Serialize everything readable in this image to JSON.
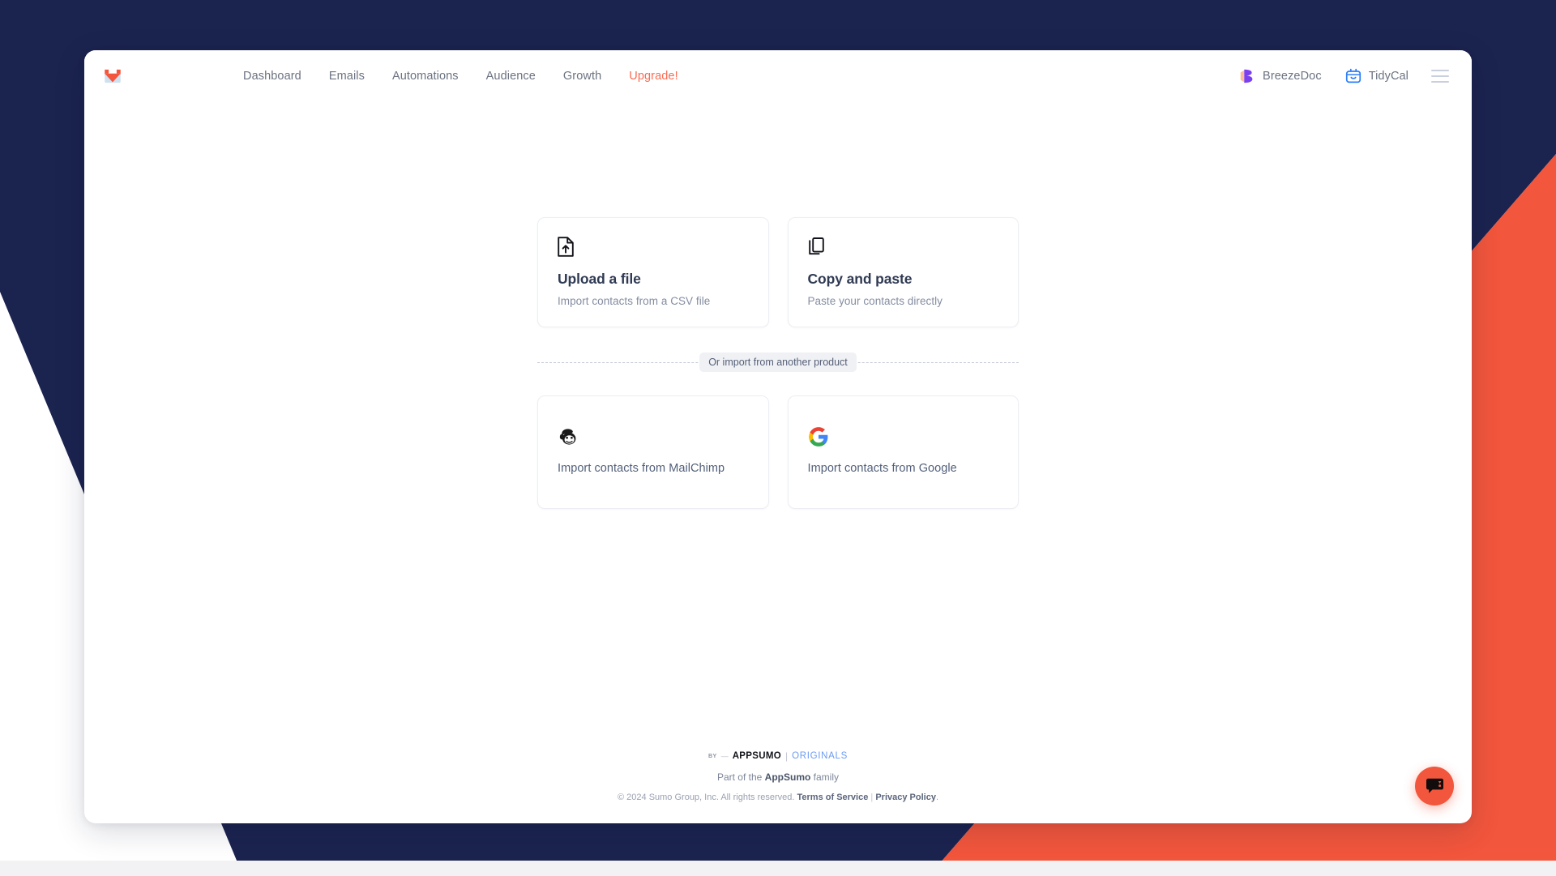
{
  "brand": {
    "logo_icon": "sendfox-fox-envelope-logo",
    "accent_coral": "#f2563c",
    "navy": "#1b234f"
  },
  "topnav": {
    "links": [
      {
        "label": "Dashboard",
        "name": "dashboard"
      },
      {
        "label": "Emails",
        "name": "emails"
      },
      {
        "label": "Automations",
        "name": "automations"
      },
      {
        "label": "Audience",
        "name": "audience"
      },
      {
        "label": "Growth",
        "name": "growth"
      },
      {
        "label": "Upgrade!",
        "name": "upgrade"
      }
    ],
    "products": [
      {
        "label": "BreezeDoc",
        "icon": "breezedoc-icon"
      },
      {
        "label": "TidyCal",
        "icon": "tidycal-icon"
      }
    ],
    "menu_icon": "hamburger-menu-icon"
  },
  "import": {
    "primary_cards": [
      {
        "icon": "file-upload-icon",
        "title": "Upload a file",
        "subtitle": "Import contacts from a CSV file"
      },
      {
        "icon": "copy-paste-icon",
        "title": "Copy and paste",
        "subtitle": "Paste your contacts directly"
      }
    ],
    "divider_label": "Or import from another product",
    "product_cards": [
      {
        "icon": "mailchimp-icon",
        "label": "Import contacts from MailChimp"
      },
      {
        "icon": "google-icon",
        "label": "Import contacts from Google"
      }
    ]
  },
  "footer": {
    "by": "BY",
    "dash": "—",
    "appsumo": "APPSUMO",
    "pipe": "|",
    "originals": "ORIGINALS",
    "family_prefix": "Part of the ",
    "family_brand": "AppSumo",
    "family_suffix": " family",
    "copyright": "© 2024 Sumo Group, Inc. All rights reserved. ",
    "terms": "Terms of Service",
    "legal_sep": " | ",
    "privacy": "Privacy Policy",
    "period": "."
  },
  "chat": {
    "icon": "chat-bubble-icon"
  }
}
